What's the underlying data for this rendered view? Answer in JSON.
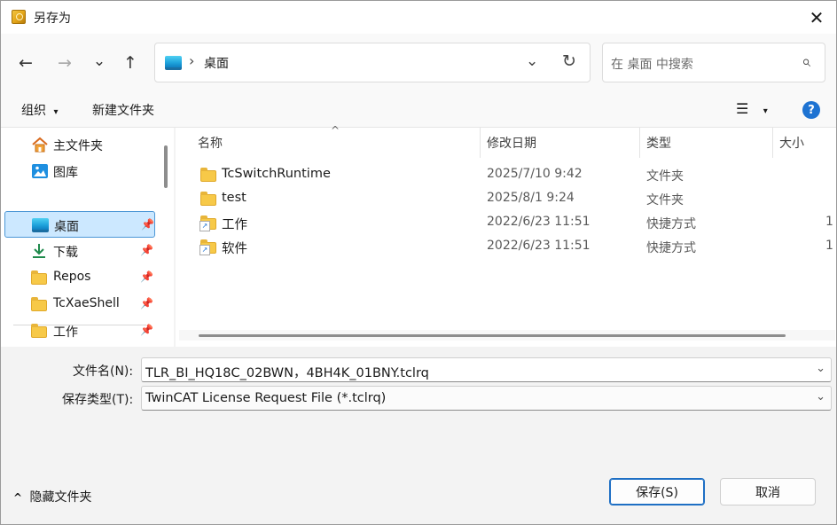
{
  "window": {
    "title": "另存为",
    "close_glyph": "✕"
  },
  "nav": {
    "back": "←",
    "forward": "→",
    "recent": "⌄",
    "up": "↑",
    "address": {
      "separator": "›",
      "location": "桌面",
      "dropdown": "⌄",
      "refresh": "↻"
    },
    "search": {
      "placeholder": "在 桌面 中搜索",
      "icon": "⌕"
    }
  },
  "toolbar": {
    "organize": "组织",
    "organize_arrow": "▾",
    "new_folder": "新建文件夹",
    "view_icon": "☰",
    "view_arrow": "▾",
    "help": "?"
  },
  "sidebar": {
    "top_items": [
      {
        "label": "主文件夹",
        "icon": "home-icon"
      },
      {
        "label": "图库",
        "icon": "gallery-icon"
      }
    ],
    "pinned": [
      {
        "label": "桌面",
        "icon": "desktop-icon",
        "selected": true
      },
      {
        "label": "下载",
        "icon": "download-icon"
      },
      {
        "label": "Repos",
        "icon": "folder-icon"
      },
      {
        "label": "TcXaeShell",
        "icon": "folder-icon"
      },
      {
        "label": "工作",
        "icon": "folder-icon"
      }
    ],
    "pin_glyph": "📌"
  },
  "files": {
    "sort_arrow": "^",
    "columns": [
      "名称",
      "修改日期",
      "类型",
      "大小"
    ],
    "rows": [
      {
        "name": "TcSwitchRuntime",
        "date": "2025/7/10 9:42",
        "type": "文件夹",
        "size": "",
        "icon": "folder-icon"
      },
      {
        "name": "test",
        "date": "2025/8/1 9:24",
        "type": "文件夹",
        "size": "",
        "icon": "folder-icon"
      },
      {
        "name": "工作",
        "date": "2022/6/23 11:51",
        "type": "快捷方式",
        "size": "1",
        "icon": "shortcut-folder-icon"
      },
      {
        "name": "软件",
        "date": "2022/6/23 11:51",
        "type": "快捷方式",
        "size": "1",
        "icon": "shortcut-folder-icon"
      }
    ]
  },
  "form": {
    "filename_label": "文件名(N):",
    "filename_value": "TLR_BI_HQ18C_02BWN，4BH4K_01BNY.tclrq",
    "type_label": "保存类型(T):",
    "type_value": "TwinCAT License Request File (*.tclrq)",
    "chevron": "⌄"
  },
  "footer": {
    "hide_folders_arrow": "^",
    "hide_folders": "隐藏文件夹",
    "save": "保存(S)",
    "cancel": "取消"
  },
  "colors": {
    "accent": "#1e73d2",
    "selection": "#cce8ff",
    "folder": "#f7c948"
  }
}
